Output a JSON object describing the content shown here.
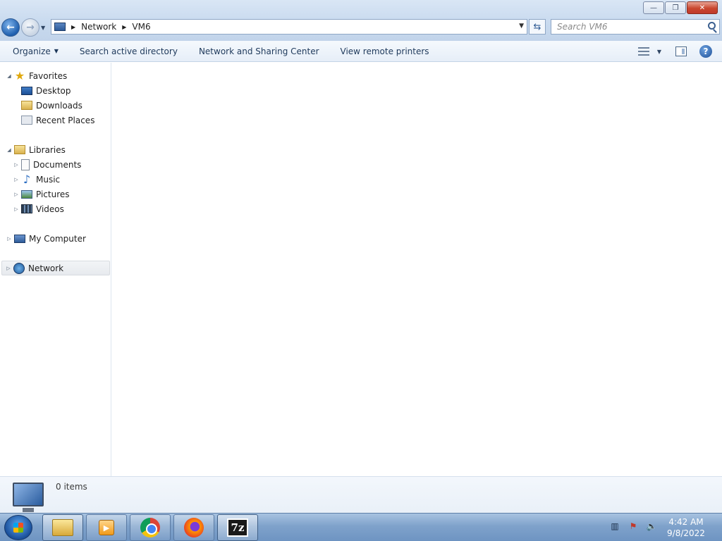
{
  "window": {
    "minimize_glyph": "—",
    "restore_glyph": "❐",
    "close_glyph": "✕"
  },
  "address": {
    "crumbs": [
      "Network",
      "VM6"
    ],
    "search_placeholder": "Search VM6"
  },
  "toolbar": {
    "organize": "Organize",
    "search_ad": "Search active directory",
    "network_sharing": "Network and Sharing Center",
    "remote_printers": "View remote printers",
    "help": "?"
  },
  "sidebar": {
    "favorites": {
      "label": "Favorites",
      "items": [
        "Desktop",
        "Downloads",
        "Recent Places"
      ]
    },
    "libraries": {
      "label": "Libraries",
      "items": [
        "Documents",
        "Music",
        "Pictures",
        "Videos"
      ]
    },
    "computer": "My Computer",
    "network": "Network"
  },
  "details": {
    "count": "0 items"
  },
  "taskbar": {
    "apps": [
      "Windows Explorer",
      "Windows Media Player",
      "Google Chrome",
      "Mozilla Firefox",
      "7-Zip"
    ],
    "sevenzip_label": "7z",
    "time": "4:42 AM",
    "date": "9/8/2022"
  },
  "icons": {
    "favorites": "star-icon",
    "music": "music-note-icon"
  }
}
